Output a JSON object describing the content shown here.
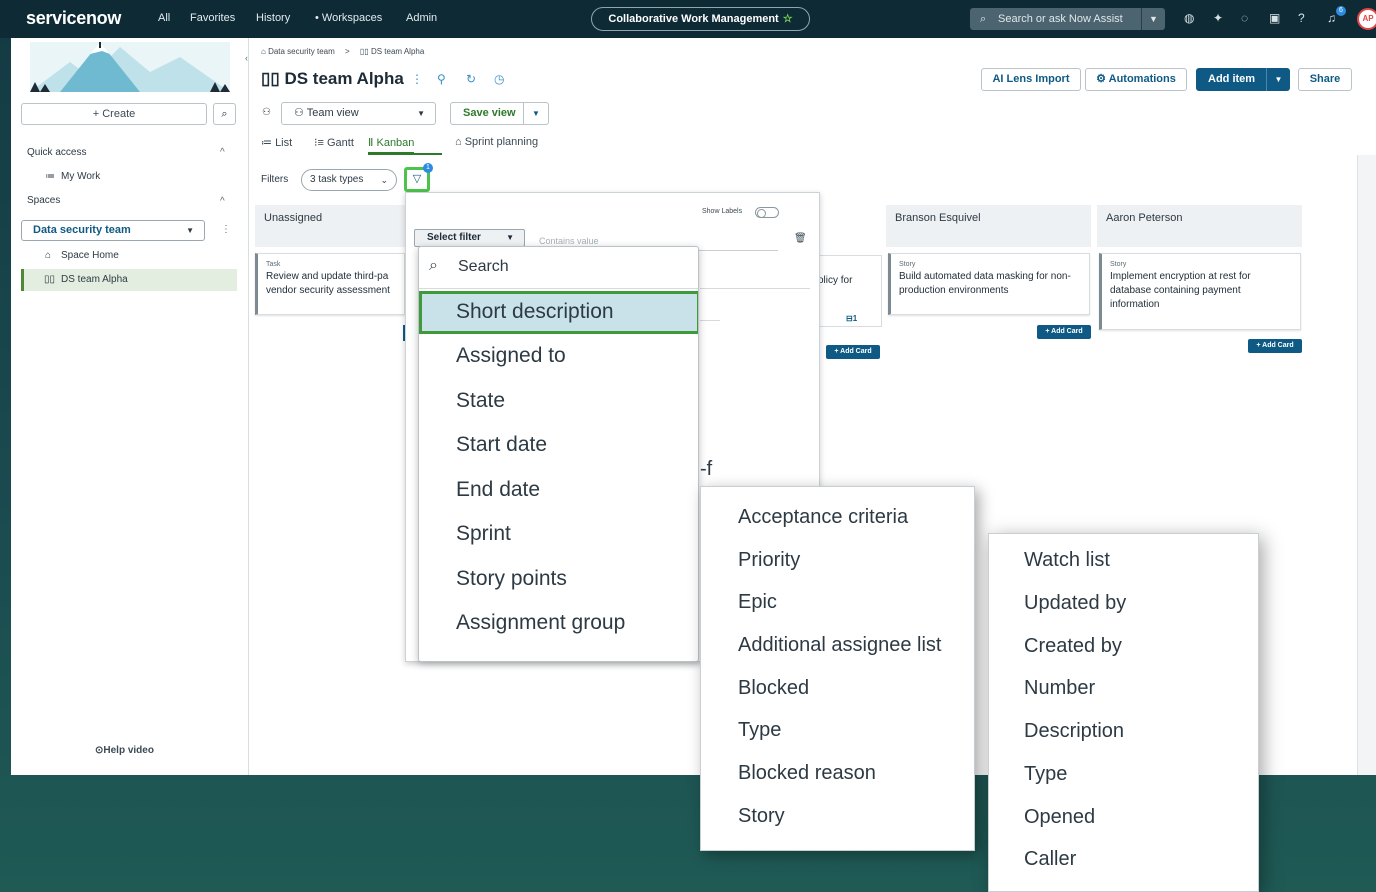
{
  "topnav": {
    "logo": "servicenow",
    "links": [
      "All",
      "Favorites",
      "History",
      "• Workspaces",
      "Admin"
    ],
    "workspace_pill": "Collaborative Work Management",
    "search_placeholder": "Search or ask Now Assist",
    "notification_count": "6",
    "avatar_initials": "AP"
  },
  "sidebar": {
    "create_label": "+ Create",
    "quick_access_label": "Quick access",
    "my_work_label": "My Work",
    "spaces_label": "Spaces",
    "space_selected": "Data security team",
    "space_home_label": "Space Home",
    "ds_team_label": "DS team Alpha",
    "help_video_label": "Help video"
  },
  "header": {
    "breadcrumb_root": "Data security team",
    "breadcrumb_sep": ">",
    "breadcrumb_current": "DS team Alpha",
    "title": "DS team Alpha",
    "ai_lens_label": "AI Lens Import",
    "automations_label": "Automations",
    "add_item_label": "Add item",
    "share_label": "Share",
    "view_label": "Team view",
    "save_view_label": "Save view"
  },
  "tabs": {
    "list": "List",
    "gantt": "Gantt",
    "kanban": "Kanban",
    "sprint": "Sprint planning"
  },
  "filters": {
    "label": "Filters",
    "task_types": "3 task types",
    "badge": "1"
  },
  "kanban": {
    "columns": [
      {
        "name": "Unassigned",
        "card_type": "Task",
        "card_text": "Review and update third-pa vendor security assessment"
      },
      {
        "name": "",
        "card_type": "",
        "card_text": "olicy for",
        "card_count": "1"
      },
      {
        "name": "Branson Esquivel",
        "card_type": "Story",
        "card_text": "Build automated data masking for non-production environments"
      },
      {
        "name": "Aaron Peterson",
        "card_type": "Story",
        "card_text": "Implement encryption at rest for database containing payment information"
      }
    ],
    "add_card_label": "+ Add Card"
  },
  "filter_popover": {
    "show_labels": "Show Labels",
    "select_filter": "Select filter",
    "contains_placeholder": "Contains value"
  },
  "field_dropdown_1": {
    "search_placeholder": "Search",
    "options": [
      "Short description",
      "Assigned to",
      "State",
      "Start date",
      "End date",
      "Sprint",
      "Story points",
      "Assignment group"
    ]
  },
  "field_dropdown_2": {
    "options": [
      "Acceptance criteria",
      "Priority",
      "Epic",
      "Additional assignee list",
      "Blocked",
      "Type",
      "Blocked reason",
      "Story"
    ]
  },
  "field_dropdown_3": {
    "options": [
      "Watch list",
      "Updated by",
      "Created by",
      "Number",
      "Description",
      "Type",
      "Opened",
      "Caller"
    ]
  },
  "fragments": {
    "f1": "-f",
    "f2": "r"
  },
  "colors": {
    "nav_bg": "#0d2a35",
    "brand_blue": "#0f5a85",
    "highlight_green": "#3f9a3a",
    "selected_bg": "#c9e2ea"
  }
}
